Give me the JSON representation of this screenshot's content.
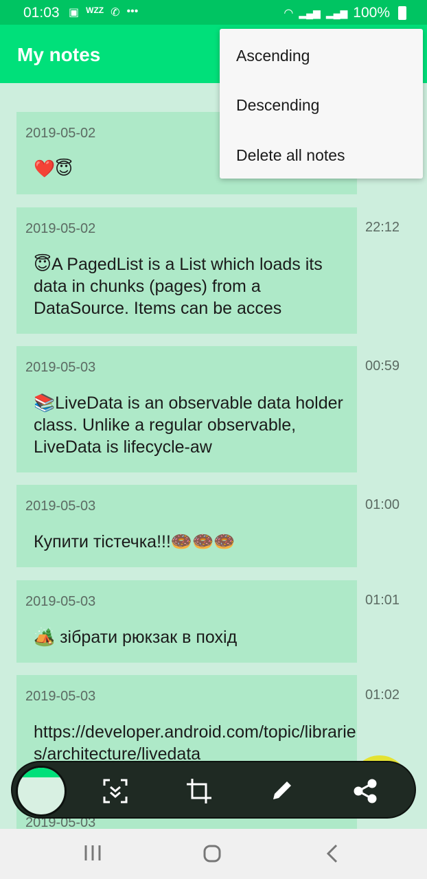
{
  "status_bar": {
    "time": "01:03",
    "left_icons": [
      "image-icon",
      "wzz-icon",
      "viber-icon",
      "more-icon"
    ],
    "battery": "100%"
  },
  "app_bar": {
    "title": "My notes"
  },
  "menu": {
    "items": [
      {
        "label": "Ascending"
      },
      {
        "label": "Descending"
      },
      {
        "label": "Delete all notes"
      }
    ]
  },
  "notes": [
    {
      "date": "2019-05-02",
      "time": "",
      "text": "❤️😇"
    },
    {
      "date": "2019-05-02",
      "time": "22:12",
      "text": "😇A PagedList is a List which loads its data in chunks (pages) from a DataSource. Items can be acces"
    },
    {
      "date": "2019-05-03",
      "time": "00:59",
      "text": "📚LiveData is an observable data holder class. Unlike a regular observable, LiveData is lifecycle-aw"
    },
    {
      "date": "2019-05-03",
      "time": "01:00",
      "text": "Купити тістечка!!!🍩🍩🍩"
    },
    {
      "date": "2019-05-03",
      "time": "01:01",
      "text": "🏕️ зібрати рюкзак в похід"
    },
    {
      "date": "2019-05-03",
      "time": "01:02",
      "text": "https://developer.android.com/topic/libraries/architecture/livedata"
    },
    {
      "date": "2019-05-03",
      "time": "",
      "text": ""
    }
  ],
  "toolbar": {
    "buttons": [
      "screenshot-thumbnail",
      "scroll-capture-icon",
      "crop-icon",
      "edit-pencil-icon",
      "share-icon"
    ]
  },
  "colors": {
    "primary": "#00e07a",
    "status": "#00c462",
    "card": "#aee9c8",
    "background": "#cdeedd"
  }
}
